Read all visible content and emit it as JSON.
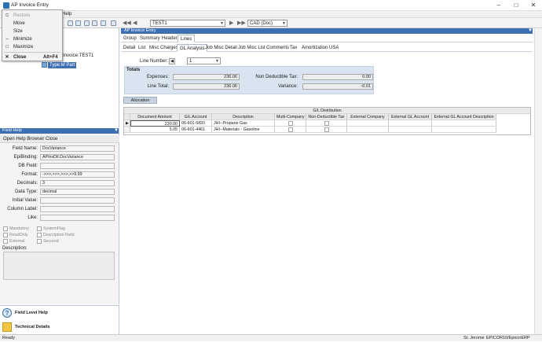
{
  "window": {
    "title": "AP Invoice Entry",
    "icon": "app-icon"
  },
  "menubar": {
    "help_label": "Help"
  },
  "toolbar": {
    "record_combo": "TEST1",
    "currency_combo": "CAD (Doc)"
  },
  "context_menu": {
    "items": [
      {
        "icon": "restore-icon",
        "label": "Restore",
        "shortcut": "",
        "disabled": true
      },
      {
        "icon": "",
        "label": "Move",
        "shortcut": "",
        "disabled": false
      },
      {
        "icon": "",
        "label": "Size",
        "shortcut": "",
        "disabled": false
      },
      {
        "icon": "minimize-icon",
        "label": "Minimize",
        "shortcut": "",
        "disabled": false
      },
      {
        "icon": "maximize-icon",
        "label": "Maximize",
        "shortcut": "",
        "disabled": false
      },
      {
        "icon": "close-icon",
        "label": "Close",
        "shortcut": "Alt+F4",
        "disabled": false
      }
    ]
  },
  "tree": {
    "invoice_label": "Invoice:TEST1",
    "type_label": "Type:M Part"
  },
  "field_help": {
    "title": "Field Help",
    "open_browser": "Open Help Browser",
    "close": "Close",
    "fields": [
      {
        "label": "Field Name:",
        "value": "DocVariance"
      },
      {
        "label": "EpiBinding:",
        "value": "APInvDtl.DocVariance"
      },
      {
        "label": "DB Field:",
        "value": ""
      },
      {
        "label": "Format:",
        "value": "->>>,>>>,>>>,>>9.99"
      },
      {
        "label": "Decimals:",
        "value": "3"
      },
      {
        "label": "Data Type:",
        "value": "decimal"
      },
      {
        "label": "Initial Value:",
        "value": ""
      },
      {
        "label": "Column Label:",
        "value": ""
      },
      {
        "label": "Like:",
        "value": ""
      }
    ],
    "checks": {
      "mandatory": "Mandatory",
      "system_flag": "SystemFlag",
      "read_only": "ReadOnly",
      "description_field": "Description Field",
      "external": "External",
      "secured": "Secured"
    },
    "description_label": "Description:"
  },
  "bottom_nav": {
    "field_level_help": "Field Level Help",
    "technical_details": "Technical Details"
  },
  "main": {
    "header": "AP Invoice Entry",
    "tabs1": [
      "Group",
      "Summary",
      "Header",
      "Lines"
    ],
    "tabs2": [
      "Detail",
      "List",
      "Misc Charges",
      "GL Analysis",
      "Job Misc Detail",
      "Job Misc List",
      "Comments",
      "Tax",
      "Amortization",
      "USA"
    ],
    "line_number_label": "Line Number:",
    "line_number_value": "1",
    "totals_label": "Totals",
    "expenses_label": "Expenses:",
    "expenses_value": "236.06",
    "line_total_label": "Line Total:",
    "line_total_value": "236.06",
    "non_deductible_label": "Non Deductible Tax:",
    "non_deductible_value": "0.00",
    "variance_label": "Variance:",
    "variance_value": "-0.01",
    "allocation_button": "Allocation",
    "grid": {
      "group_header": "G/L Distribution",
      "columns": [
        "Document Amount",
        "G/L Account",
        "Description",
        "Multi-Company",
        "Non-Deductible Tax",
        "External Company",
        "External GL Account",
        "External GL Account Description"
      ],
      "rows": [
        {
          "amount": "230.00",
          "account": "06-601-5820",
          "description": "JHI--Propane Gas"
        },
        {
          "amount": "5.05",
          "account": "06-601-4461",
          "description": "JHI--Materials - Gasoline"
        }
      ]
    }
  },
  "status": {
    "left": "Ready",
    "user": "St. Jerome",
    "server": "EPICOR10/EpicorERP"
  }
}
